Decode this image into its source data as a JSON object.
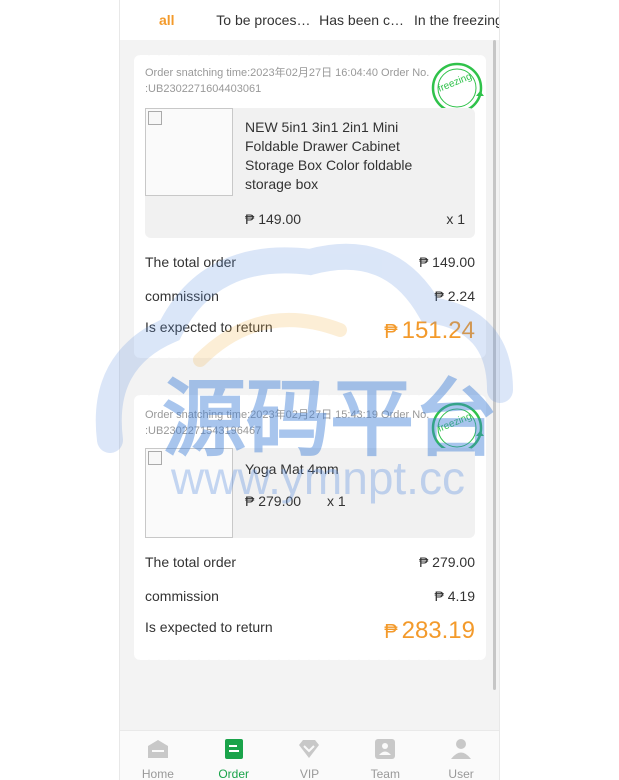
{
  "tabs": [
    "all",
    "To be processed",
    "Has been completed",
    "In the freezing"
  ],
  "orders": [
    {
      "meta": "Order snatching time:2023年02月27日 16:04:40 Order No. :UB2302271604403061",
      "stamp_text": "freezing",
      "product_name": "NEW 5in1 3in1 2in1 Mini Foldable Drawer Cabinet Storage Box Color foldable storage box",
      "price": "₱ 149.00",
      "qty": "x 1",
      "total_label": "The total order",
      "total_value": "₱ 149.00",
      "commission_label": "commission",
      "commission_value": "₱ 2.24",
      "return_label": "Is expected to return",
      "return_currency": "₱",
      "return_value": "151.24"
    },
    {
      "meta": "Order snatching time:2023年02月27日 15:43:19 Order No. :UB2302271543196467",
      "stamp_text": "freezing",
      "product_name": "Yoga Mat 4mm",
      "price": "₱ 279.00",
      "qty": "x 1",
      "total_label": "The total order",
      "total_value": "₱ 279.00",
      "commission_label": "commission",
      "commission_value": "₱ 4.19",
      "return_label": "Is expected to return",
      "return_currency": "₱",
      "return_value": "283.19"
    }
  ],
  "nav": [
    {
      "label": "Home",
      "icon": "home-icon"
    },
    {
      "label": "Order",
      "icon": "order-icon"
    },
    {
      "label": "VIP",
      "icon": "vip-icon"
    },
    {
      "label": "Team",
      "icon": "team-icon"
    },
    {
      "label": "User",
      "icon": "user-icon"
    }
  ],
  "watermark": {
    "title": "源码平台",
    "url": "www.ymnpt.cc"
  },
  "colors": {
    "accent": "#f39a2b",
    "active_nav": "#1aa34a",
    "stamp": "#2fc24a"
  }
}
